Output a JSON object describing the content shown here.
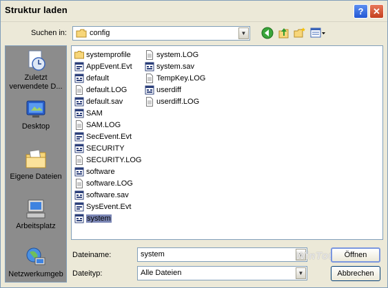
{
  "window": {
    "title": "Struktur laden"
  },
  "lookin": {
    "label": "Suchen in:",
    "value": "config"
  },
  "places": [
    {
      "label": "Zuletzt verwendete D...",
      "icon": "recent-documents-icon"
    },
    {
      "label": "Desktop",
      "icon": "desktop-icon"
    },
    {
      "label": "Eigene Dateien",
      "icon": "my-documents-icon"
    },
    {
      "label": "Arbeitsplatz",
      "icon": "my-computer-icon"
    },
    {
      "label": "Netzwerkumgeb",
      "icon": "network-icon"
    }
  ],
  "files": {
    "column1": [
      {
        "name": "systemprofile",
        "icon": "folder-icon"
      },
      {
        "name": "AppEvent.Evt",
        "icon": "event-file-icon"
      },
      {
        "name": "default",
        "icon": "registry-file-icon"
      },
      {
        "name": "default.LOG",
        "icon": "text-file-icon"
      },
      {
        "name": "default.sav",
        "icon": "registry-file-icon"
      },
      {
        "name": "SAM",
        "icon": "registry-file-icon"
      },
      {
        "name": "SAM.LOG",
        "icon": "text-file-icon"
      },
      {
        "name": "SecEvent.Evt",
        "icon": "event-file-icon"
      },
      {
        "name": "SECURITY",
        "icon": "registry-file-icon"
      },
      {
        "name": "SECURITY.LOG",
        "icon": "text-file-icon"
      },
      {
        "name": "software",
        "icon": "registry-file-icon"
      },
      {
        "name": "software.LOG",
        "icon": "text-file-icon"
      },
      {
        "name": "software.sav",
        "icon": "registry-file-icon"
      },
      {
        "name": "SysEvent.Evt",
        "icon": "event-file-icon"
      },
      {
        "name": "system",
        "icon": "registry-file-icon",
        "selected": true
      }
    ],
    "column2": [
      {
        "name": "system.LOG",
        "icon": "text-file-icon"
      },
      {
        "name": "system.sav",
        "icon": "registry-file-icon"
      },
      {
        "name": "TempKey.LOG",
        "icon": "text-file-icon"
      },
      {
        "name": "userdiff",
        "icon": "registry-file-icon"
      },
      {
        "name": "userdiff.LOG",
        "icon": "text-file-icon"
      }
    ]
  },
  "filename": {
    "label": "Dateiname:",
    "value": "system"
  },
  "filetype": {
    "label": "Dateityp:",
    "value": "Alle Dateien"
  },
  "buttons": {
    "open": "Öffnen",
    "cancel": "Abbrechen"
  },
  "watermark": "WinTotal",
  "colors": {
    "selection": "#7b86b5",
    "places_bg": "#8c8c8c",
    "dialog_bg": "#ece9d8"
  }
}
